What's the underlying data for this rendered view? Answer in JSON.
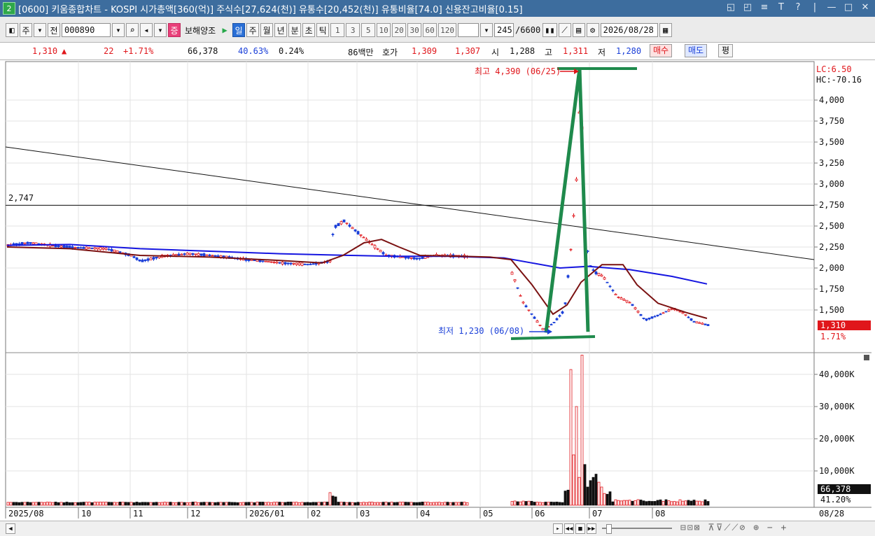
{
  "window": {
    "number": "2",
    "title": "[0600] 키움종합차트 - KOSPI 시가총액[360(억)] 주식수[27,624(천)] 유통수[20,452(천)] 유통비율[74.0] 신용잔고비율[0.15]",
    "controls": [
      "◱",
      "◰",
      "≡",
      "T",
      "?",
      "|",
      "—",
      "□",
      "✕"
    ]
  },
  "toolbar": {
    "period_label": "주",
    "range_label": "전",
    "code": "000890",
    "stock_badge": "증",
    "stock_name": "보해양조",
    "interval_tabs": [
      "일",
      "주",
      "월",
      "년",
      "분",
      "초",
      "틱"
    ],
    "interval_active": "일",
    "numbers": [
      "1",
      "3",
      "5",
      "10",
      "20",
      "30",
      "60",
      "120"
    ],
    "count": "245",
    "total": "/6600",
    "date": "2026/08/28"
  },
  "quote": {
    "price": "1,310",
    "change": "22",
    "change_pct": "+1.71%",
    "volume": "66,378",
    "vol_ratio": "40.63%",
    "turnover": "0.24%",
    "amount": "86백만",
    "hoga_label": "호가",
    "ask": "1,309",
    "bid": "1,307",
    "open_label": "시",
    "open": "1,288",
    "high_label": "고",
    "high": "1,311",
    "low_label": "저",
    "low": "1,280",
    "buy_label": "매수",
    "sell_label": "매도",
    "flat_label": "평"
  },
  "chart": {
    "hline_label": "2,747",
    "max_annotation": "최고 4,390 (06/25)",
    "min_annotation": "최저 1,230 (06/08)",
    "lc": "LC:6.50",
    "hc": "HC:-70.16",
    "price_axis": [
      "4,000",
      "3,750",
      "3,500",
      "3,250",
      "3,000",
      "2,750",
      "2,500",
      "2,250",
      "2,000",
      "1,750",
      "1,500"
    ],
    "price_tag": "1,310",
    "price_tag_pct": "1.71%",
    "volume_axis": [
      "40,000K",
      "30,000K",
      "20,000K",
      "10,000K"
    ],
    "volume_tag": "66,378",
    "volume_tag_pct": "41.20%",
    "x_labels": [
      "2025/08",
      "10",
      "11",
      "12",
      "2026/01",
      "02",
      "03",
      "04",
      "05",
      "06",
      "07",
      "08"
    ],
    "x_end": "08/28",
    "colors": {
      "up": "#e0161b",
      "down": "#1a3fd8",
      "ma_short": "#7a1111",
      "ma_long": "#1515e0",
      "annotation": "#1f8a4c"
    }
  },
  "chart_data": {
    "type": "line",
    "title": "",
    "series": [
      {
        "name": "",
        "x": [
          "2025/08",
          "2025/09",
          "2025/10",
          "2025/11",
          "2025/12",
          "2026/01",
          "2026/02",
          "2026/02",
          "2026/03",
          "2026/04",
          "2026/05",
          "2026/05",
          "2026/06/08",
          "2026/06/20",
          "2026/06/25",
          "2026/07",
          "2026/07",
          "2026/08",
          "2026/08/28"
        ],
        "values": [
          2280,
          2240,
          2220,
          2100,
          2180,
          2120,
          2060,
          2560,
          2200,
          2110,
          2150,
          1900,
          1230,
          1800,
          4390,
          1900,
          2000,
          1380,
          1310
        ]
      }
    ],
    "volume_K": [
      200,
      150,
      150,
      120,
      200,
      150,
      2000,
      1500,
      800,
      500,
      600,
      400,
      700,
      2500,
      46000,
      8000,
      3000,
      1500,
      66
    ],
    "ylim": [
      1230,
      4390
    ],
    "hline": 2747,
    "max": {
      "label": "최고",
      "value": 4390,
      "date": "06/25"
    },
    "min": {
      "label": "최저",
      "value": 1230,
      "date": "06/08"
    }
  }
}
